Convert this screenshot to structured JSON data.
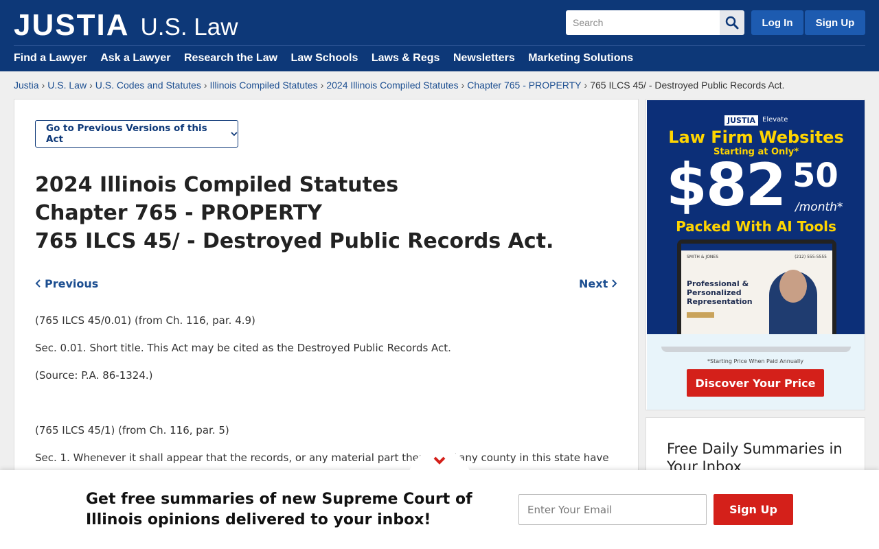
{
  "header": {
    "logo_main": "JUSTIA",
    "logo_sub": "U.S. Law",
    "search_placeholder": "Search",
    "login_label": "Log In",
    "signup_label": "Sign Up",
    "nav": [
      "Find a Lawyer",
      "Ask a Lawyer",
      "Research the Law",
      "Law Schools",
      "Laws & Regs",
      "Newsletters",
      "Marketing Solutions"
    ]
  },
  "breadcrumb": {
    "items": [
      "Justia",
      "U.S. Law",
      "U.S. Codes and Statutes",
      "Illinois Compiled Statutes",
      "2024 Illinois Compiled Statutes",
      "Chapter 765 - PROPERTY"
    ],
    "current": "765 ILCS 45/ - Destroyed Public Records Act.",
    "separator": "›"
  },
  "main": {
    "prev_versions_label": "Go to Previous Versions of this Act",
    "title_lines": [
      "2024 Illinois Compiled Statutes",
      "Chapter 765 - PROPERTY",
      "765 ILCS 45/ - Destroyed Public Records Act."
    ],
    "previous_label": "Previous",
    "next_label": "Next",
    "paragraphs": [
      "(765 ILCS 45/0.01) (from Ch. 116, par. 4.9)",
      "Sec. 0.01. Short title. This Act may be cited as the Destroyed Public Records Act.",
      "(Source: P.A. 86-1324.)",
      "(765 ILCS 45/1) (from Ch. 116, par. 5)",
      "Sec. 1. Whenever it shall appear that the records, or any material part thereof, of any county in this state have"
    ]
  },
  "ad": {
    "badge": "JUSTIA",
    "badge_text": "Elevate",
    "headline": "Law Firm Websites",
    "subheadline": "Starting at Only*",
    "price": "$82",
    "cents": "50",
    "per_month": "/month*",
    "tools": "Packed With AI Tools",
    "screen_brand": "SMITH & JONES",
    "screen_phone": "(212) 555-5555",
    "screen_text": "Professional & Personalized Representation",
    "note": "*Starting Price When Paid Annually",
    "cta": "Discover Your Price"
  },
  "summaries": {
    "title": "Free Daily Summaries in Your Inbox"
  },
  "banner": {
    "text": "Get free summaries of new Supreme Court of Illinois opinions delivered to your inbox!",
    "email_placeholder": "Enter Your Email",
    "button_label": "Sign Up"
  },
  "colors": {
    "brand_navy": "#0d3878",
    "button_blue": "#1d5bb0",
    "cta_red": "#d4201a",
    "link_blue": "#1d4f91",
    "ad_yellow": "#ffd500"
  }
}
